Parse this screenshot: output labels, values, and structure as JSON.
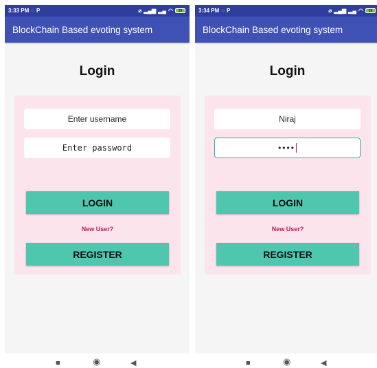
{
  "screens": [
    {
      "status": {
        "time": "3:33 PM",
        "battery": "39"
      },
      "app_title": "BlockChain Based evoting system",
      "heading": "Login",
      "username": {
        "placeholder": "Enter username",
        "value": ""
      },
      "password": {
        "placeholder": "Enter password",
        "masked": ""
      },
      "login_label": "LOGIN",
      "new_user_label": "New User?",
      "register_label": "REGISTER"
    },
    {
      "status": {
        "time": "3:34 PM",
        "battery": "39"
      },
      "app_title": "BlockChain Based evoting system",
      "heading": "Login",
      "username": {
        "placeholder": "",
        "value": "Niraj"
      },
      "password": {
        "placeholder": "",
        "masked": "••••"
      },
      "login_label": "LOGIN",
      "new_user_label": "New User?",
      "register_label": "REGISTER"
    }
  ],
  "colors": {
    "status_bar": "#2f3e9e",
    "app_bar": "#3f51b5",
    "card": "#fce4ec",
    "button": "#4fc7ae",
    "link": "#c2185b",
    "focus_border": "#3aa99a"
  },
  "icons": {
    "status_left": [
      "whatsapp-icon",
      "p-app-icon"
    ],
    "status_right": [
      "alarm-off-icon",
      "signal-icon",
      "signal-2-icon",
      "wifi-icon",
      "battery-icon"
    ],
    "nav": [
      "recents-icon",
      "home-icon",
      "back-icon"
    ]
  }
}
